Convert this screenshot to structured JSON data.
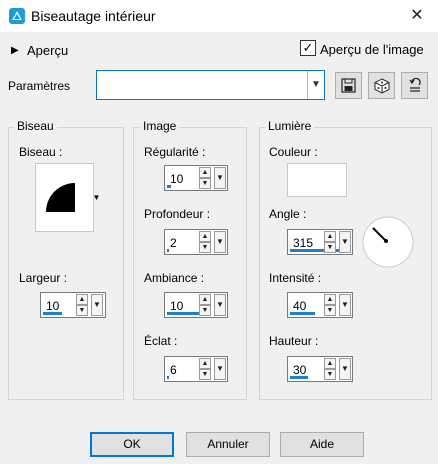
{
  "window": {
    "title": "Biseautage intérieur",
    "close_glyph": "✕"
  },
  "preview": {
    "toggle_label": "Aperçu",
    "checkbox_label": "Aperçu de l'image",
    "checkbox_checked": true
  },
  "presets": {
    "label": "Paramètres",
    "value": ""
  },
  "icons": {
    "app": "bevel-app-icon",
    "save": "save-icon",
    "random": "dice-icon",
    "reset": "reset-icon"
  },
  "groups": {
    "biseau": "Biseau",
    "image": "Image",
    "lumiere": "Lumière"
  },
  "biseau": {
    "shape_label": "Biseau :",
    "width_label": "Largeur :",
    "width_value": "10"
  },
  "image": {
    "smoothness_label": "Régularité :",
    "smoothness_value": "10",
    "depth_label": "Profondeur :",
    "depth_value": "2",
    "ambience_label": "Ambiance :",
    "ambience_value": "10",
    "shininess_label": "Éclat :",
    "shininess_value": "6"
  },
  "lumiere": {
    "color_label": "Couleur :",
    "color_value": "#ffffff",
    "angle_label": "Angle :",
    "angle_value": "315",
    "intensity_label": "Intensité :",
    "intensity_value": "40",
    "elevation_label": "Hauteur :",
    "elevation_value": "30"
  },
  "buttons": {
    "ok": "OK",
    "cancel": "Annuler",
    "help": "Aide"
  },
  "colors": {
    "accent": "#0078d7",
    "bar": "#1e7fd0"
  }
}
